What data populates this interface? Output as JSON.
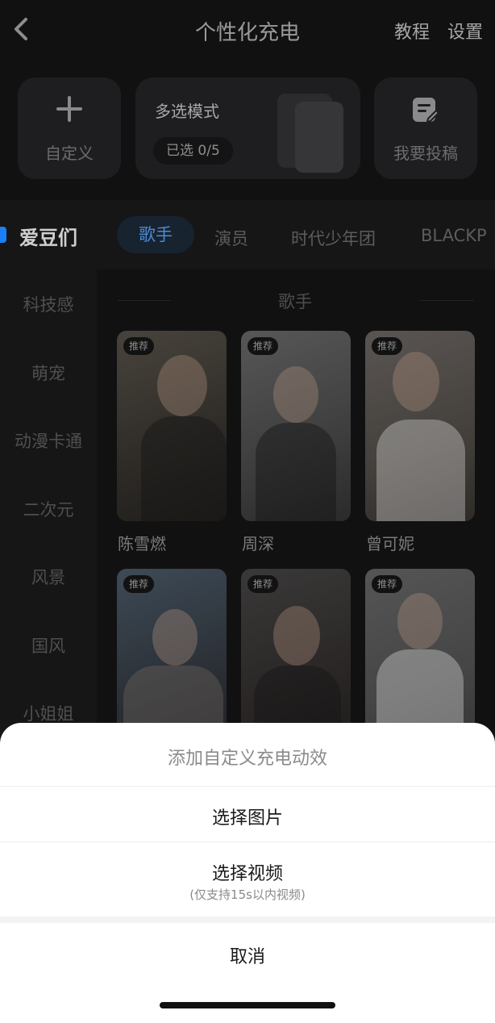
{
  "header": {
    "title": "个性化充电",
    "tutorial": "教程",
    "settings": "设置"
  },
  "cards": {
    "custom_label": "自定义",
    "multi_title": "多选模式",
    "multi_selected": "已选 0/5",
    "submit_label": "我要投稿"
  },
  "categories": {
    "active": "爱豆们",
    "tabs": [
      "歌手",
      "演员",
      "时代少年团",
      "BLACKP"
    ]
  },
  "sidebar": {
    "items": [
      "科技感",
      "萌宠",
      "动漫卡通",
      "二次元",
      "风景",
      "国风",
      "小姐姐"
    ]
  },
  "section_title": "歌手",
  "badge": "推荐",
  "artists": [
    {
      "name": "陈雪燃"
    },
    {
      "name": "周深"
    },
    {
      "name": "曾可妮"
    },
    {
      "name": ""
    },
    {
      "name": ""
    },
    {
      "name": ""
    }
  ],
  "sheet": {
    "title": "添加自定义充电动效",
    "option_image": "选择图片",
    "option_video": "选择视频",
    "video_note": "(仅支持15s以内视频)",
    "cancel": "取消"
  },
  "colors": {
    "accent": "#1d7ff5",
    "sheet_bg": "#ffffff",
    "page_bg": "#111112"
  }
}
